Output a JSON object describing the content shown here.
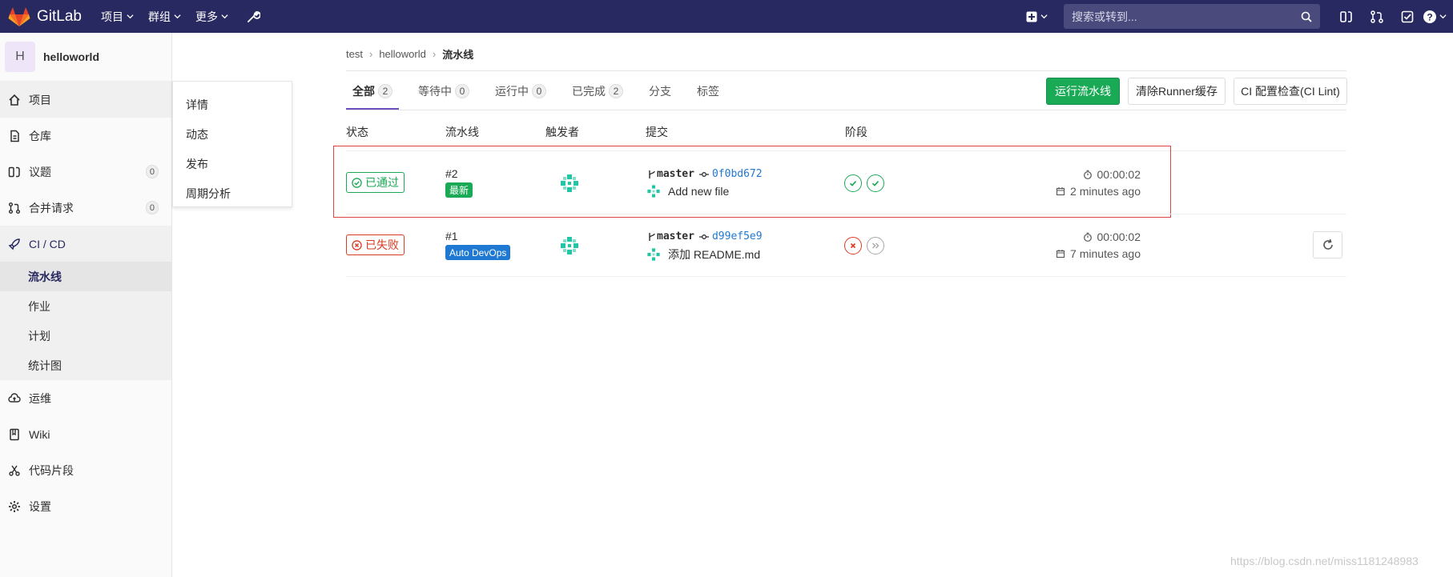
{
  "nav": {
    "brand": "GitLab",
    "menu": [
      "项目",
      "群组",
      "更多"
    ],
    "search_placeholder": "搜索或转到..."
  },
  "sidebar": {
    "avatar_letter": "H",
    "project_name": "helloworld",
    "items": [
      {
        "label": "项目",
        "icon": "home-icon"
      },
      {
        "label": "仓库",
        "icon": "doc-icon"
      },
      {
        "label": "议题",
        "icon": "issues-icon",
        "count": "0"
      },
      {
        "label": "合并请求",
        "icon": "merge-request-icon",
        "count": "0"
      }
    ],
    "ci": {
      "label": "CI / CD",
      "sub": [
        "流水线",
        "作业",
        "计划",
        "统计图"
      ]
    },
    "bottom": [
      {
        "label": "运维",
        "icon": "cloud-icon"
      },
      {
        "label": "Wiki",
        "icon": "book-icon"
      },
      {
        "label": "代码片段",
        "icon": "scissors-icon"
      },
      {
        "label": "设置",
        "icon": "gear-icon"
      }
    ]
  },
  "flyout": [
    "详情",
    "动态",
    "发布",
    "周期分析"
  ],
  "breadcrumb": [
    "test",
    "helloworld",
    "流水线"
  ],
  "tabs": [
    {
      "label": "全部",
      "count": "2"
    },
    {
      "label": "等待中",
      "count": "0"
    },
    {
      "label": "运行中",
      "count": "0"
    },
    {
      "label": "已完成",
      "count": "2"
    },
    {
      "label": "分支"
    },
    {
      "label": "标签"
    }
  ],
  "buttons": {
    "run": "运行流水线",
    "clear": "清除Runner缓存",
    "lint": "CI 配置检查(CI Lint)"
  },
  "table": {
    "headers": [
      "状态",
      "流水线",
      "触发者",
      "提交",
      "阶段"
    ],
    "rows": [
      {
        "status": "已通过",
        "id": "#2",
        "tag": "最新",
        "branch": "master",
        "sha": "0f0bd672",
        "message": "Add new file",
        "duration": "00:00:02",
        "ago": "2 minutes ago"
      },
      {
        "status": "已失败",
        "id": "#1",
        "tag": "Auto DevOps",
        "branch": "master",
        "sha": "d99ef5e9",
        "message": "添加 README.md",
        "duration": "00:00:02",
        "ago": "7 minutes ago"
      }
    ]
  },
  "watermark": "https://blog.csdn.net/miss1181248983",
  "colors": {
    "navbar": "#292961",
    "success": "#1aaa55",
    "danger": "#db3b21",
    "link": "#1f78d1"
  }
}
